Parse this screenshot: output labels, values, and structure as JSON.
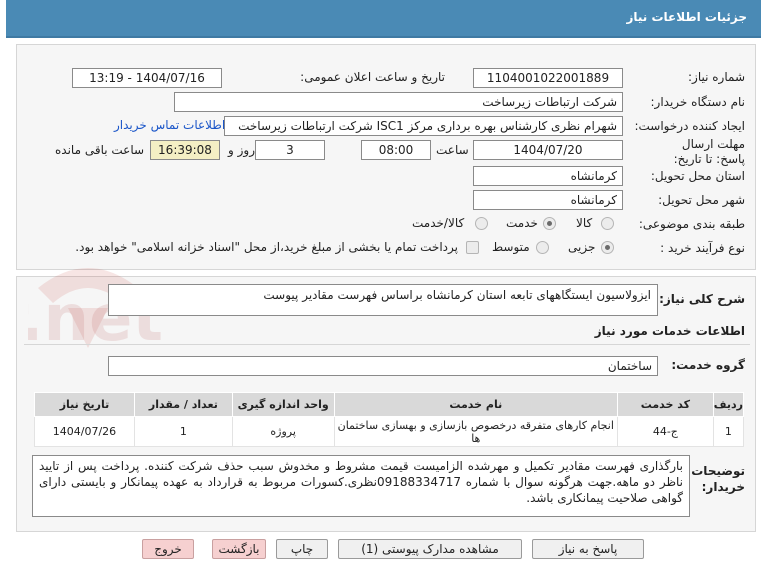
{
  "header": {
    "title": "جزئیات اطلاعات نیاز"
  },
  "form": {
    "need_number": {
      "label": "شماره نیاز:",
      "value": "1104001022001889"
    },
    "announce_datetime": {
      "label": "تاریخ و ساعت اعلان عمومی:",
      "value": "1404/07/16 - 13:19"
    },
    "buyer_org": {
      "label": "نام دستگاه خریدار:",
      "value": "شرکت ارتباطات زیرساخت"
    },
    "requester": {
      "label": "ایجاد کننده درخواست:",
      "value": "شهرام نظری کارشناس بهره برداری مرکز ISC1 شرکت ارتباطات زیرساخت"
    },
    "contact_link": "اطلاعات تماس خریدار",
    "deadline": {
      "label": "مهلت ارسال پاسخ: تا تاریخ:",
      "date": "1404/07/20",
      "time_label": "ساعت",
      "time": "08:00",
      "days": "3",
      "days_label": "روز و",
      "remaining_time": "16:39:08",
      "remaining_label": "ساعت باقی مانده"
    },
    "province": {
      "label": "استان محل تحویل:",
      "value": "کرمانشاه"
    },
    "city": {
      "label": "شهر محل تحویل:",
      "value": "کرمانشاه"
    },
    "category": {
      "label": "طبقه بندی موضوعی:",
      "options": [
        "کالا",
        "خدمت",
        "کالا/خدمت"
      ],
      "selected": "خدمت"
    },
    "purchase_type": {
      "label": "نوع فرآیند خرید :",
      "options": [
        "جزیی",
        "متوسط"
      ],
      "selected": "جزیی",
      "note": "پرداخت تمام یا بخشی از مبلغ خرید،از محل \"اسناد خزانه اسلامی\" خواهد بود."
    }
  },
  "summary": {
    "label": "شرح کلی نیاز:",
    "value": "ایزولاسیون ایستگاههای تابعه استان کرمانشاه براساس فهرست مقادیر پیوست"
  },
  "services": {
    "section_title": "اطلاعات خدمات مورد نیاز",
    "group_label": "گروه خدمت:",
    "group_value": "ساختمان",
    "columns": [
      "ردیف",
      "کد خدمت",
      "نام خدمت",
      "واحد اندازه گیری",
      "تعداد / مقدار",
      "تاریخ نیاز"
    ],
    "rows": [
      {
        "index": "1",
        "code": "ج-44",
        "name": "انجام کارهای متفرقه درخصوص بازسازی و بهسازی ساختمان ها",
        "unit": "پروژه",
        "qty": "1",
        "date": "1404/07/26"
      }
    ]
  },
  "buyer_notes": {
    "label": "توضیحات خریدار:",
    "value": "بارگذاری فهرست مقادیر تکمیل و مهرشده الزامیست  قیمت مشروط و مخدوش سبب حذف شرکت کنندە. پرداخت پس از تایید ناظر دو ماهه.جهت هرگونه سوال با شماره 09188334717نظری.کسورات مربوط به قرارداد به عهده پیمانکار و بایستی دارای گواهی صلاحیت پیمانکاری باشد."
  },
  "buttons": {
    "reply": "پاسخ به نیاز",
    "view_docs": "مشاهده مدارک پیوستی (1)",
    "print": "چاپ",
    "back": "بازگشت",
    "exit": "خروج"
  },
  "watermark": {
    "text": "AriaTender.net"
  },
  "colors": {
    "header_bg": "#4a8ab5",
    "link": "#1a55c8",
    "highlight": "#f4efc4",
    "exit_btn": "#f6d0d0"
  }
}
